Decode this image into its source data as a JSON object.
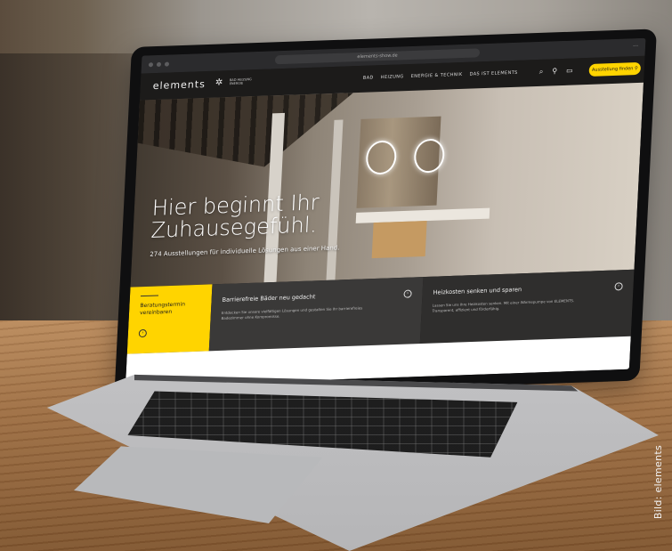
{
  "browser": {
    "url": "elements-show.de"
  },
  "site": {
    "logo_text": "elements",
    "logo_sub": "BAD HEIZUNG ENERGIE",
    "menu": [
      "BAD",
      "HEIZUNG",
      "ENERGIE & TECHNIK",
      "DAS IST ELEMENTS"
    ],
    "cta_label": "Ausstellung finden"
  },
  "hero": {
    "title_line1": "Hier beginnt Ihr",
    "title_line2": "Zuhausegefühl.",
    "subtitle": "274 Ausstellungen für individuelle Lösungen aus einer Hand."
  },
  "tiles": {
    "yellow_label": "Beratungstermin vereinbaren",
    "tile1_title": "Barrierefreie Bäder neu gedacht",
    "tile1_text": "Entdecken Sie unsere vielfältigen Lösungen und gestalten Sie Ihr barrierefreies Badezimmer ohne Kompromisse.",
    "tile2_title": "Heizkosten senken und sparen",
    "tile2_text": "Lassen Sie uns Ihre Heizkosten senken. Mit einer Wärmepumpe von ELEMENTS. Transparent, effizient und förderfähig."
  },
  "photo_credit": "Bild: elements",
  "colors": {
    "accent_yellow": "#ffd400",
    "nav_dark": "#1c1b1a",
    "tile_dark": "#3a3938"
  }
}
